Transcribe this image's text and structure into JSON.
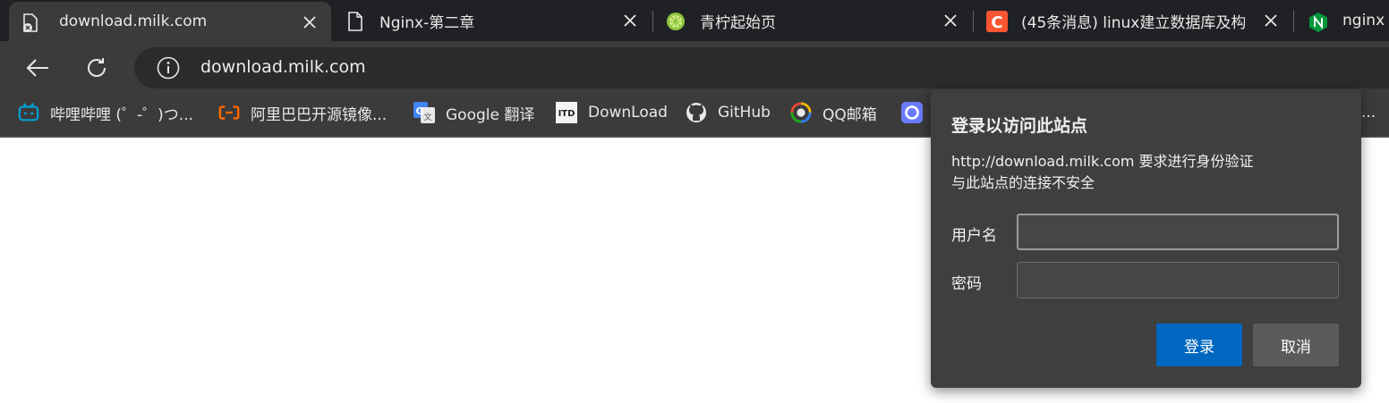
{
  "tabs": [
    {
      "label": "download.milk.com",
      "icon": "page-error-icon",
      "active": true
    },
    {
      "label": "Nginx-第二章",
      "icon": "page-icon",
      "active": false
    },
    {
      "label": "青柠起始页",
      "icon": "lime-icon",
      "active": false
    },
    {
      "label": "(45条消息) linux建立数据库及构",
      "icon": "csdn-icon",
      "active": false
    },
    {
      "label": "nginx d",
      "icon": "nginx-icon",
      "active": false
    }
  ],
  "omnibox": {
    "url": "download.milk.com",
    "icon": "info-icon"
  },
  "bookmarks": [
    {
      "label": "哔哩哔哩 (゜-゜)つ...",
      "icon": "bilibili-icon"
    },
    {
      "label": "阿里巴巴开源镜像...",
      "icon": "aliyun-icon"
    },
    {
      "label": "Google 翻译",
      "icon": "google-translate-icon"
    },
    {
      "label": "DownLoad",
      "icon": "download-site-icon"
    },
    {
      "label": "GitHub",
      "icon": "github-icon"
    },
    {
      "label": "QQ邮箱",
      "icon": "qqmail-icon"
    },
    {
      "label": "",
      "icon": "circle-app-icon"
    }
  ],
  "overflow_text": "...",
  "dialog": {
    "title": "登录以访问此站点",
    "message_line1": "http://download.milk.com 要求进行身份验证",
    "message_line2": "与此站点的连接不安全",
    "username_label": "用户名",
    "username_value": "",
    "password_label": "密码",
    "password_value": "",
    "login_button": "登录",
    "cancel_button": "取消"
  },
  "colors": {
    "tabstrip_bg": "#202124",
    "toolbar_bg": "#3b3b3b",
    "dialog_bg": "#3f3f3f",
    "primary_button": "#0067c0",
    "secondary_button": "#5a5a5a"
  }
}
